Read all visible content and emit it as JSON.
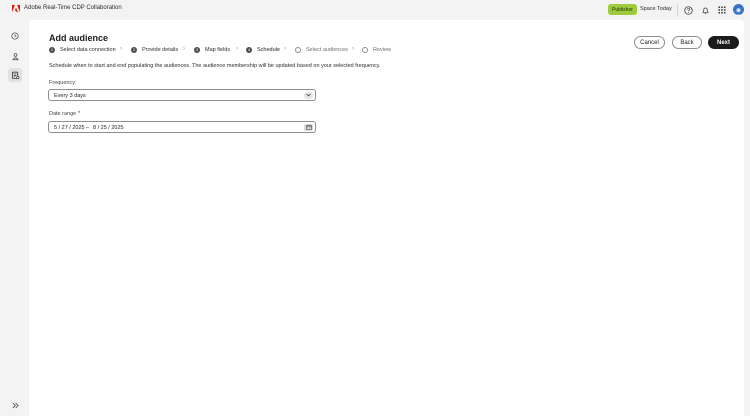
{
  "app": {
    "title": "Adobe Real-Time CDP Collaboration"
  },
  "topbar": {
    "role_badge": "Publisher",
    "org_name": "Space Today",
    "icons": [
      "help-icon",
      "bell-icon",
      "app-grid-icon",
      "avatar"
    ]
  },
  "rail": {
    "items": [
      "clock-icon",
      "people-icon",
      "audience-icon"
    ],
    "expand_icon": "double-chevron-right-icon"
  },
  "page": {
    "title": "Add audience",
    "buttons": {
      "cancel": "Cancel",
      "back": "Back",
      "next": "Next"
    }
  },
  "steps": [
    {
      "number": "1",
      "label": "Select data connection",
      "state": "done"
    },
    {
      "number": "2",
      "label": "Provide details",
      "state": "done"
    },
    {
      "number": "3",
      "label": "Map fields",
      "state": "done"
    },
    {
      "number": "4",
      "label": "Schedule",
      "state": "current"
    },
    {
      "number": "",
      "label": "Select audiences",
      "state": "pending"
    },
    {
      "number": "",
      "label": "Review",
      "state": "pending"
    }
  ],
  "schedule": {
    "description": "Schedule when to start and end populating the audiences. The audience membership will be updated based on your selected frequency.",
    "frequency_label": "Frequency:",
    "frequency_value": "Every 3 days",
    "date_range_label": "Date range",
    "required_mark": "*",
    "start_date": "5 / 27 / 2025",
    "separator": "–",
    "end_date": "8 / 25 / 2025"
  },
  "colors": {
    "badge": "#9ecb3c",
    "primary": "#1b1b1b",
    "logo": "#eb1000",
    "avatar": "#3b73c8"
  }
}
